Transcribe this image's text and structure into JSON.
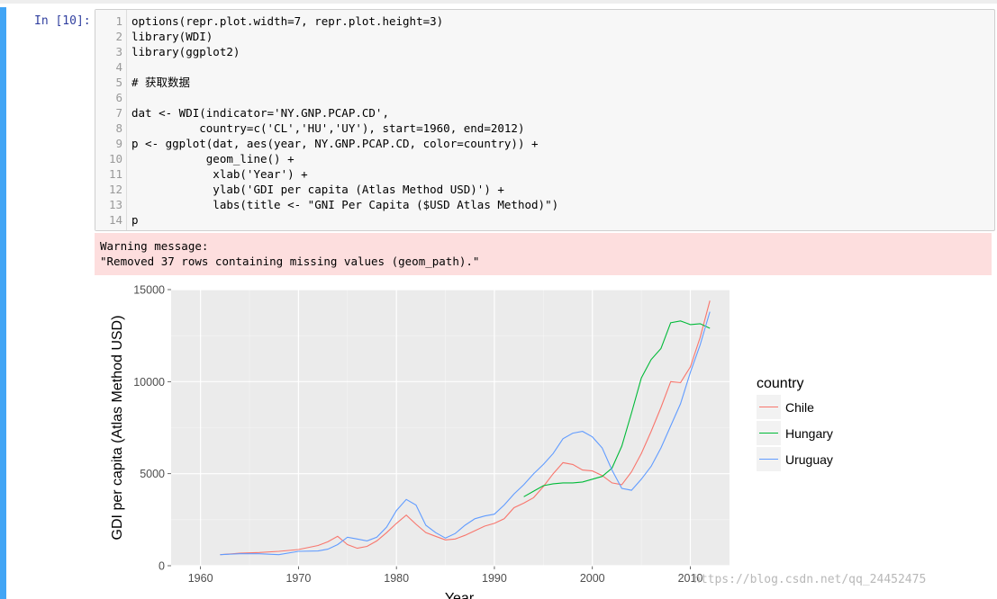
{
  "cell": {
    "prompt": "In [10]:",
    "lines": [
      {
        "n": "1",
        "text": "options(repr.plot.width=7, repr.plot.height=3)"
      },
      {
        "n": "2",
        "text": "library(WDI)"
      },
      {
        "n": "3",
        "text": "library(ggplot2)"
      },
      {
        "n": "4",
        "text": ""
      },
      {
        "n": "5",
        "text": "# 获取数据"
      },
      {
        "n": "6",
        "text": ""
      },
      {
        "n": "7",
        "text": "dat <- WDI(indicator='NY.GNP.PCAP.CD',"
      },
      {
        "n": "8",
        "text": "          country=c('CL','HU','UY'), start=1960, end=2012)"
      },
      {
        "n": "9",
        "text": "p <- ggplot(dat, aes(year, NY.GNP.PCAP.CD, color=country)) +"
      },
      {
        "n": "10",
        "text": "           geom_line() +"
      },
      {
        "n": "11",
        "text": "            xlab('Year') +"
      },
      {
        "n": "12",
        "text": "            ylab('GDI per capita (Atlas Method USD)') +"
      },
      {
        "n": "13",
        "text": "            labs(title <- \"GNI Per Capita ($USD Atlas Method)\")"
      },
      {
        "n": "14",
        "text": "p"
      }
    ]
  },
  "warning": {
    "line1": "Warning message:",
    "line2": "\"Removed 37 rows containing missing values (geom_path).\""
  },
  "chart_data": {
    "type": "line",
    "title": "",
    "xlabel": "Year",
    "ylabel": "GDI per capita (Atlas Method USD)",
    "xlim": [
      1957,
      2014
    ],
    "ylim": [
      0,
      15000
    ],
    "x_ticks": [
      1960,
      1970,
      1980,
      1990,
      2000,
      2010
    ],
    "y_ticks": [
      0,
      5000,
      10000,
      15000
    ],
    "grid": true,
    "legend_title": "country",
    "legend_position": "right",
    "series": [
      {
        "name": "Chile",
        "color": "#F8766D",
        "x": [
          1962,
          1964,
          1966,
          1968,
          1970,
          1972,
          1973,
          1974,
          1975,
          1976,
          1977,
          1978,
          1979,
          1980,
          1981,
          1982,
          1983,
          1984,
          1985,
          1986,
          1987,
          1988,
          1989,
          1990,
          1991,
          1992,
          1993,
          1994,
          1995,
          1996,
          1997,
          1998,
          1999,
          2000,
          2001,
          2002,
          2003,
          2004,
          2005,
          2006,
          2007,
          2008,
          2009,
          2010,
          2011,
          2012
        ],
        "y": [
          600,
          680,
          720,
          780,
          880,
          1100,
          1300,
          1600,
          1150,
          950,
          1050,
          1350,
          1800,
          2300,
          2750,
          2250,
          1800,
          1600,
          1400,
          1450,
          1650,
          1900,
          2150,
          2300,
          2550,
          3150,
          3400,
          3700,
          4300,
          5000,
          5600,
          5500,
          5200,
          5150,
          4900,
          4500,
          4400,
          5100,
          6100,
          7300,
          8600,
          10000,
          9950,
          10800,
          12400,
          14400
        ]
      },
      {
        "name": "Hungary",
        "color": "#00BA38",
        "x": [
          1993,
          1994,
          1995,
          1996,
          1997,
          1998,
          1999,
          2000,
          2001,
          2002,
          2003,
          2004,
          2005,
          2006,
          2007,
          2008,
          2009,
          2010,
          2011,
          2012
        ],
        "y": [
          3750,
          4050,
          4350,
          4450,
          4500,
          4500,
          4550,
          4700,
          4850,
          5300,
          6500,
          8300,
          10200,
          11200,
          11800,
          13200,
          13300,
          13100,
          13150,
          12900
        ]
      },
      {
        "name": "Uruguay",
        "color": "#619CFF",
        "x": [
          1962,
          1964,
          1966,
          1968,
          1970,
          1972,
          1973,
          1974,
          1975,
          1976,
          1977,
          1978,
          1979,
          1980,
          1981,
          1982,
          1983,
          1984,
          1985,
          1986,
          1987,
          1988,
          1989,
          1990,
          1991,
          1992,
          1993,
          1994,
          1995,
          1996,
          1997,
          1998,
          1999,
          2000,
          2001,
          2002,
          2003,
          2004,
          2005,
          2006,
          2007,
          2008,
          2009,
          2010,
          2011,
          2012
        ],
        "y": [
          600,
          650,
          650,
          600,
          780,
          800,
          900,
          1150,
          1550,
          1450,
          1350,
          1550,
          2100,
          3000,
          3600,
          3300,
          2200,
          1800,
          1500,
          1750,
          2200,
          2550,
          2700,
          2800,
          3300,
          3900,
          4400,
          5000,
          5500,
          6100,
          6900,
          7200,
          7300,
          7000,
          6400,
          5200,
          4200,
          4100,
          4700,
          5400,
          6400,
          7600,
          8800,
          10500,
          12000,
          13800
        ]
      }
    ]
  },
  "watermark": "https://blog.csdn.net/qq_24452475"
}
